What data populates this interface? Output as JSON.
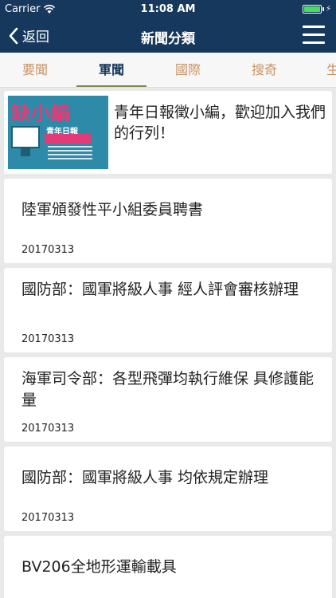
{
  "status_bar": {
    "carrier": "Carrier",
    "time": "11:08 AM",
    "battery_level": 1.0
  },
  "nav": {
    "back_label": "返回",
    "title": "新聞分類"
  },
  "tabs": [
    {
      "label": "要聞",
      "active": false
    },
    {
      "label": "軍聞",
      "active": true
    },
    {
      "label": "國際",
      "active": false
    },
    {
      "label": "搜奇",
      "active": false
    },
    {
      "label": "生",
      "active": false
    }
  ],
  "banner": {
    "image_text_top": "缺小編",
    "image_text_mid": "青年日報",
    "text": "青年日報徵小編，歡迎加入我們的行列！"
  },
  "news": [
    {
      "title": "陸軍頒發性平小組委員聘書",
      "date": "20170313"
    },
    {
      "title": "國防部：國軍將級人事  經人評會審核辦理",
      "date": "20170313"
    },
    {
      "title": "海軍司令部：各型飛彈均執行維保  具修護能量",
      "date": "20170313"
    },
    {
      "title": "國防部：國軍將級人事  均依規定辦理",
      "date": "20170313"
    },
    {
      "title": "BV206全地形運輸載具",
      "date": ""
    }
  ],
  "colors": {
    "nav_bg": "#16385c",
    "tab_inactive": "#c89466",
    "tab_active": "#16385c",
    "tab_underline": "#7b8a4e"
  }
}
